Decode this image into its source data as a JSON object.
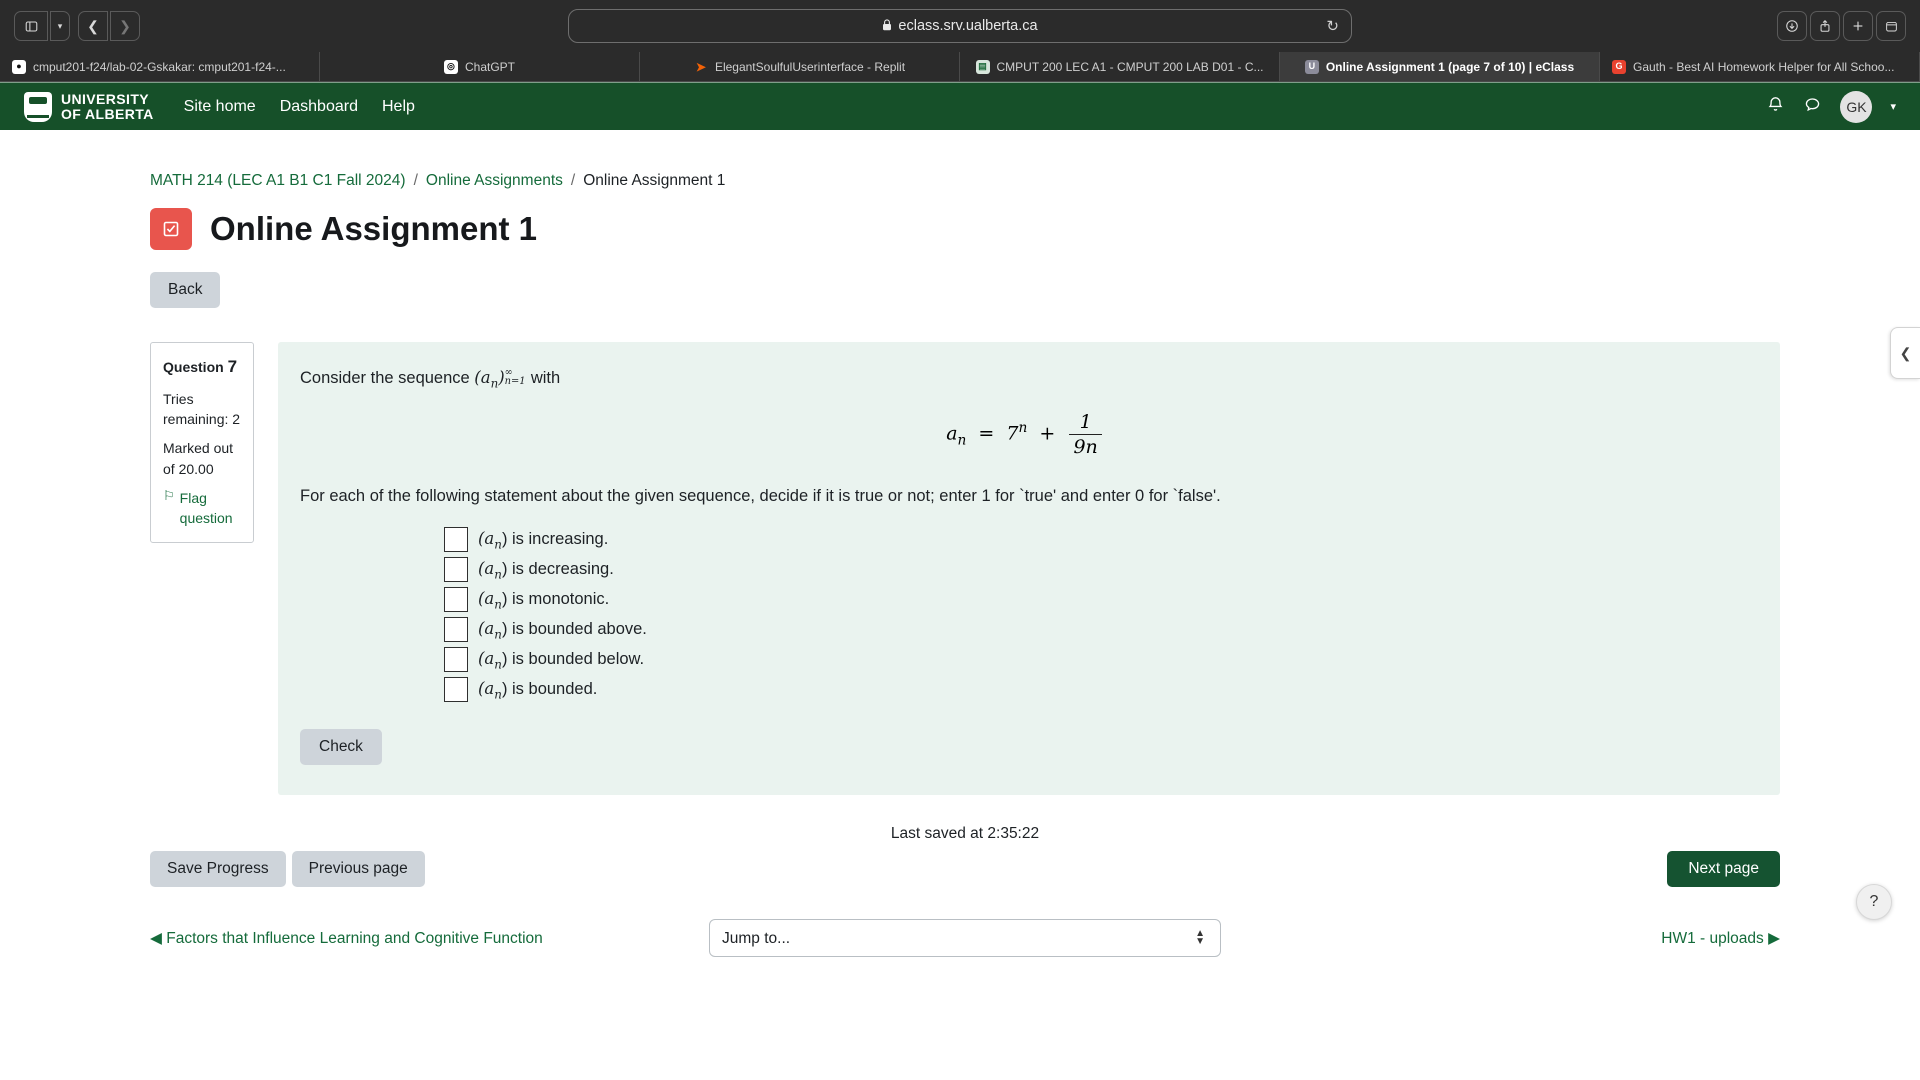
{
  "browser": {
    "url": "eclass.srv.ualberta.ca",
    "lock_icon": "lock-icon",
    "reload_icon": "reload-icon",
    "sidebar_icon": "sidebar-toggle-icon",
    "caret_icon": "chevron-down-icon",
    "back_icon": "back-arrow-icon",
    "forward_icon": "forward-arrow-icon",
    "download_icon": "downloads-icon",
    "share_icon": "share-icon",
    "newtab_icon": "new-tab-icon",
    "tabs_overview_icon": "tab-overview-icon",
    "tabs": [
      {
        "title": "cmput201-f24/lab-02-Gskakar: cmput201-f24-...",
        "favicon": "github-icon",
        "favicon_color": "#ffffff",
        "favicon_text": "●",
        "active": false
      },
      {
        "title": "ChatGPT",
        "favicon": "chatgpt-icon",
        "favicon_color": "#ffffff",
        "favicon_text": "◎",
        "active": false
      },
      {
        "title": "ElegantSoulfulUserinterface - Replit",
        "favicon": "replit-icon",
        "favicon_color": "#f26207",
        "favicon_text": "▸",
        "active": false
      },
      {
        "title": "CMPUT 200 LEC A1 - CMPUT 200 LAB D01 - C...",
        "favicon": "eclass-icon",
        "favicon_color": "#1f6b3c",
        "favicon_text": "▤",
        "active": false
      },
      {
        "title": "Online Assignment 1 (page 7 of 10) | eClass",
        "favicon": "eclass-u-icon",
        "favicon_color": "#8c8c9a",
        "favicon_text": "U",
        "active": true
      },
      {
        "title": "Gauth - Best AI Homework Helper for All Schoo...",
        "favicon": "gauth-icon",
        "favicon_color": "#e8422f",
        "favicon_text": "G",
        "active": false
      }
    ]
  },
  "site_header": {
    "logo_line1": "UNIVERSITY",
    "logo_line2": "OF ALBERTA",
    "logo_icon": "ualberta-shield-icon",
    "nav": [
      {
        "label": "Site home"
      },
      {
        "label": "Dashboard"
      },
      {
        "label": "Help"
      }
    ],
    "notifications_icon": "bell-icon",
    "messages_icon": "chat-bubble-icon",
    "avatar_initials": "GK",
    "user_caret_icon": "chevron-down-icon",
    "brand_green": "#165029"
  },
  "drawer": {
    "toggle_icon": "chevron-left-icon"
  },
  "breadcrumb": {
    "items": [
      {
        "label": "MATH 214 (LEC A1 B1 C1 Fall 2024)",
        "link": true
      },
      {
        "label": "Online Assignments",
        "link": true
      },
      {
        "label": "Online Assignment 1",
        "link": false
      }
    ],
    "separator": "/"
  },
  "page": {
    "title": "Online Assignment 1",
    "title_icon": "assignment-icon",
    "title_badge_color": "#e8554d",
    "back_label": "Back"
  },
  "question": {
    "number_label": "Question",
    "number": "7",
    "tries_label": "Tries remaining: 2",
    "marked_label": "Marked out of 20.00",
    "flag_label": "Flag question",
    "flag_icon": "flag-icon",
    "intro_text": "Consider the sequence",
    "sequence_notation": "(a_n)_{n=1}^{∞}",
    "intro_tail": "with",
    "formula": "a_n = 7^n + 1/(9n)",
    "formula_parts": {
      "lhs_base": "a",
      "lhs_sub": "n",
      "equals": "=",
      "term1_base": "7",
      "term1_sup": "n",
      "plus": "+",
      "frac_num": "1",
      "frac_den_coef": "9",
      "frac_den_var": "n"
    },
    "instruction": "For each of the following statement about the given sequence, decide if it is true or not; enter 1 for `true' and enter 0 for `false'.",
    "statements": [
      {
        "prefix": "(a",
        "sub": "n",
        "suffix": ") is increasing.",
        "value": ""
      },
      {
        "prefix": "(a",
        "sub": "n",
        "suffix": ") is decreasing.",
        "value": ""
      },
      {
        "prefix": "(a",
        "sub": "n",
        "suffix": ") is monotonic.",
        "value": ""
      },
      {
        "prefix": "(a",
        "sub": "n",
        "suffix": ") is bounded above.",
        "value": ""
      },
      {
        "prefix": "(a",
        "sub": "n",
        "suffix": ") is bounded below.",
        "value": ""
      },
      {
        "prefix": "(a",
        "sub": "n",
        "suffix": ") is bounded.",
        "value": ""
      }
    ],
    "check_label": "Check"
  },
  "footer_nav": {
    "saved_text": "Last saved at 2:35:22",
    "save_progress_label": "Save Progress",
    "previous_page_label": "Previous page",
    "next_page_label": "Next page",
    "prev_activity_label": "Factors that Influence Learning and Cognitive Function",
    "prev_activity_icon": "triangle-left-icon",
    "next_activity_label": "HW1 - uploads",
    "next_activity_icon": "triangle-right-icon",
    "jump_placeholder": "Jump to...",
    "jump_selected": "Jump to...",
    "jump_arrows_icon": "select-arrows-icon"
  },
  "help": {
    "label": "?",
    "icon": "question-mark-icon"
  }
}
